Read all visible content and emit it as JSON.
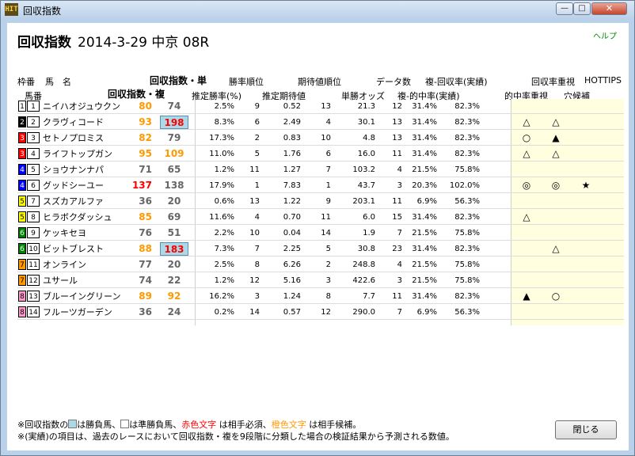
{
  "window": {
    "title": "回収指数",
    "icon_label": "HIT"
  },
  "page": {
    "title": "回収指数",
    "race": "2014-3-29 中京 08R",
    "help": "ヘルプ"
  },
  "headers": {
    "row1": {
      "waku": "枠番",
      "name": "馬　名",
      "index_tan": "回収指数・単",
      "rate_rank": "勝率順位",
      "exp_rank": "期待値順位",
      "data_count": "データ数",
      "fuku_back": "複-回収率(実績)",
      "back_priority": "回収率重視",
      "hottips": "HOTTIPS"
    },
    "row2": {
      "uma": "馬番",
      "index_fuku": "回収指数・複",
      "est_rate": "推定勝率(%)",
      "est_exp": "推定期待値",
      "odds": "単勝オッズ",
      "fuku_hit": "複-的中率(実績)",
      "hit_priority": "的中率重視",
      "ana": "穴候補"
    }
  },
  "rows": [
    {
      "waku": "1",
      "uma": "1",
      "name": "ニイハオジュウクン",
      "tan": "80",
      "fuku": "74",
      "rate": "2.5%",
      "rrank": "9",
      "exp": "0.52",
      "erank": "13",
      "odds": "21.3",
      "cnt": "12",
      "fhit": "31.4%",
      "fback": "82.3%",
      "m1": "",
      "m2": "",
      "m3": ""
    },
    {
      "waku": "2",
      "uma": "2",
      "name": "クラヴィコード",
      "tan": "93",
      "fuku": "198",
      "rate": "8.3%",
      "rrank": "6",
      "exp": "2.49",
      "erank": "4",
      "odds": "30.1",
      "cnt": "13",
      "fhit": "31.4%",
      "fback": "82.3%",
      "m1": "△",
      "m2": "△",
      "m3": ""
    },
    {
      "waku": "3",
      "uma": "3",
      "name": "セトノプロミス",
      "tan": "82",
      "fuku": "79",
      "rate": "17.3%",
      "rrank": "2",
      "exp": "0.83",
      "erank": "10",
      "odds": "4.8",
      "cnt": "13",
      "fhit": "31.4%",
      "fback": "82.3%",
      "m1": "○",
      "m2": "▲",
      "m3": ""
    },
    {
      "waku": "3",
      "uma": "4",
      "name": "ライフトップガン",
      "tan": "95",
      "fuku": "109",
      "rate": "11.0%",
      "rrank": "5",
      "exp": "1.76",
      "erank": "6",
      "odds": "16.0",
      "cnt": "11",
      "fhit": "31.4%",
      "fback": "82.3%",
      "m1": "△",
      "m2": "△",
      "m3": ""
    },
    {
      "waku": "4",
      "uma": "5",
      "name": "ショウナンナパ",
      "tan": "71",
      "fuku": "65",
      "rate": "1.2%",
      "rrank": "11",
      "exp": "1.27",
      "erank": "7",
      "odds": "103.2",
      "cnt": "4",
      "fhit": "21.5%",
      "fback": "75.8%",
      "m1": "",
      "m2": "",
      "m3": ""
    },
    {
      "waku": "4",
      "uma": "6",
      "name": "グッドシーユー",
      "tan": "137",
      "fuku": "138",
      "rate": "17.9%",
      "rrank": "1",
      "exp": "7.83",
      "erank": "1",
      "odds": "43.7",
      "cnt": "3",
      "fhit": "20.3%",
      "fback": "102.0%",
      "m1": "◎",
      "m2": "◎",
      "m3": "★"
    },
    {
      "waku": "5",
      "uma": "7",
      "name": "スズカアルファ",
      "tan": "36",
      "fuku": "20",
      "rate": "0.6%",
      "rrank": "13",
      "exp": "1.22",
      "erank": "9",
      "odds": "203.1",
      "cnt": "11",
      "fhit": "6.9%",
      "fback": "56.3%",
      "m1": "",
      "m2": "",
      "m3": ""
    },
    {
      "waku": "5",
      "uma": "8",
      "name": "ヒラボクダッシュ",
      "tan": "85",
      "fuku": "69",
      "rate": "11.6%",
      "rrank": "4",
      "exp": "0.70",
      "erank": "11",
      "odds": "6.0",
      "cnt": "15",
      "fhit": "31.4%",
      "fback": "82.3%",
      "m1": "△",
      "m2": "",
      "m3": ""
    },
    {
      "waku": "6",
      "uma": "9",
      "name": "ケッキセヨ",
      "tan": "76",
      "fuku": "51",
      "rate": "2.2%",
      "rrank": "10",
      "exp": "0.04",
      "erank": "14",
      "odds": "1.9",
      "cnt": "7",
      "fhit": "21.5%",
      "fback": "75.8%",
      "m1": "",
      "m2": "",
      "m3": ""
    },
    {
      "waku": "6",
      "uma": "10",
      "name": "ビットブレスト",
      "tan": "88",
      "fuku": "183",
      "rate": "7.3%",
      "rrank": "7",
      "exp": "2.25",
      "erank": "5",
      "odds": "30.8",
      "cnt": "23",
      "fhit": "31.4%",
      "fback": "82.3%",
      "m1": "",
      "m2": "△",
      "m3": ""
    },
    {
      "waku": "7",
      "uma": "11",
      "name": "オンライン",
      "tan": "77",
      "fuku": "20",
      "rate": "2.5%",
      "rrank": "8",
      "exp": "6.26",
      "erank": "2",
      "odds": "248.8",
      "cnt": "4",
      "fhit": "21.5%",
      "fback": "75.8%",
      "m1": "",
      "m2": "",
      "m3": ""
    },
    {
      "waku": "7",
      "uma": "12",
      "name": "ユサール",
      "tan": "74",
      "fuku": "22",
      "rate": "1.2%",
      "rrank": "12",
      "exp": "5.16",
      "erank": "3",
      "odds": "422.6",
      "cnt": "3",
      "fhit": "21.5%",
      "fback": "75.8%",
      "m1": "",
      "m2": "",
      "m3": ""
    },
    {
      "waku": "8",
      "uma": "13",
      "name": "ブルーイングリーン",
      "tan": "89",
      "fuku": "92",
      "rate": "16.2%",
      "rrank": "3",
      "exp": "1.24",
      "erank": "8",
      "odds": "7.7",
      "cnt": "11",
      "fhit": "31.4%",
      "fback": "82.3%",
      "m1": "▲",
      "m2": "○",
      "m3": ""
    },
    {
      "waku": "8",
      "uma": "14",
      "name": "フルーツガーデン",
      "tan": "36",
      "fuku": "24",
      "rate": "0.2%",
      "rrank": "14",
      "exp": "0.57",
      "erank": "12",
      "odds": "290.0",
      "cnt": "7",
      "fhit": "6.9%",
      "fback": "56.3%",
      "m1": "",
      "m2": "",
      "m3": ""
    }
  ],
  "waku_colors": {
    "1": {
      "bg": "#ffffff",
      "fg": "#000000"
    },
    "2": {
      "bg": "#000000",
      "fg": "#ffffff"
    },
    "3": {
      "bg": "#ff0000",
      "fg": "#ffffff"
    },
    "4": {
      "bg": "#0000ff",
      "fg": "#ffffff"
    },
    "5": {
      "bg": "#ffff00",
      "fg": "#000000"
    },
    "6": {
      "bg": "#008000",
      "fg": "#ffffff"
    },
    "7": {
      "bg": "#ff9900",
      "fg": "#000000"
    },
    "8": {
      "bg": "#ff99cc",
      "fg": "#000000"
    }
  },
  "index_colors": {
    "red": "#ff0000",
    "orange": "#ff9900",
    "gray": "#666666"
  },
  "tan_color_keys": [
    "orange",
    "orange",
    "orange",
    "orange",
    "gray",
    "red",
    "gray",
    "orange",
    "gray",
    "orange",
    "gray",
    "gray",
    "orange",
    "gray"
  ],
  "fuku_color_keys": [
    "gray",
    "red",
    "gray",
    "orange",
    "gray",
    "gray",
    "gray",
    "gray",
    "gray",
    "red",
    "gray",
    "gray",
    "orange",
    "gray"
  ],
  "fuku_boxed": [
    false,
    true,
    false,
    false,
    false,
    false,
    false,
    false,
    false,
    true,
    false,
    false,
    false,
    false
  ],
  "notes": {
    "l1_a": "※回収指数の",
    "l1_b": "は勝負馬、",
    "l1_c": "は準勝負馬、",
    "l1_red": "赤色文字",
    "l1_d": " は相手必須、",
    "l1_orange": "橙色文字",
    "l1_e": " は相手候補。",
    "l2": "※(実績)の項目は、過去のレースにおいて回収指数・複を9段階に分類した場合の検証結果から予測される数値。"
  },
  "buttons": {
    "close": "閉じる"
  },
  "window_buttons": {
    "min": "—",
    "max": "□",
    "close": "✕"
  }
}
